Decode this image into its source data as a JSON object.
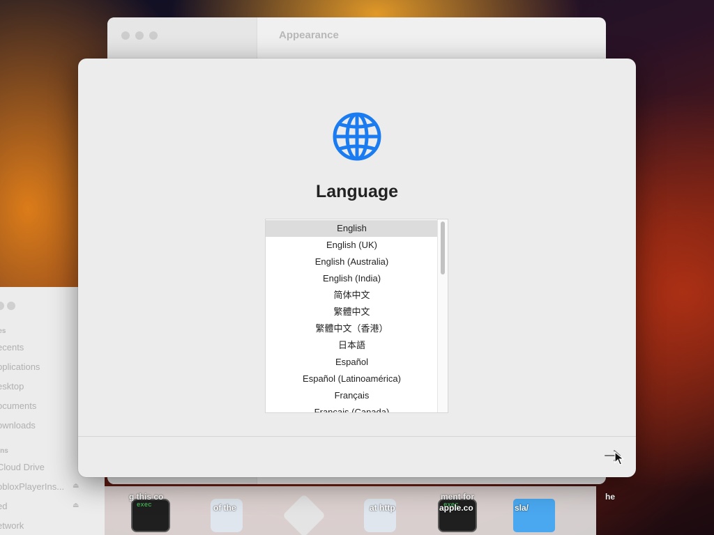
{
  "settings_window": {
    "title": "Appearance"
  },
  "finder": {
    "section_favorites": "tes",
    "favorites": [
      "ecents",
      "pplications",
      "esktop",
      "ocuments",
      "ownloads"
    ],
    "section_locations": "ons",
    "locations": [
      "Cloud Drive",
      "obloxPlayerIns...",
      "ed",
      "etwork"
    ]
  },
  "dock": {
    "terminal_text": "exec",
    "labels": [
      "g this co",
      "of the",
      "at http",
      "ment for",
      "apple.co",
      "sla/",
      "he"
    ]
  },
  "dialog": {
    "title": "Language",
    "globe_icon": "globe-icon",
    "accent_color": "#1a7cf0",
    "languages": [
      "English",
      "English (UK)",
      "English (Australia)",
      "English (India)",
      "简体中文",
      "繁體中文",
      "繁體中文（香港）",
      "日本語",
      "Español",
      "Español (Latinoamérica)",
      "Français",
      "Français (Canada)"
    ],
    "selected_language": "English",
    "continue_icon": "arrow-right-icon"
  }
}
